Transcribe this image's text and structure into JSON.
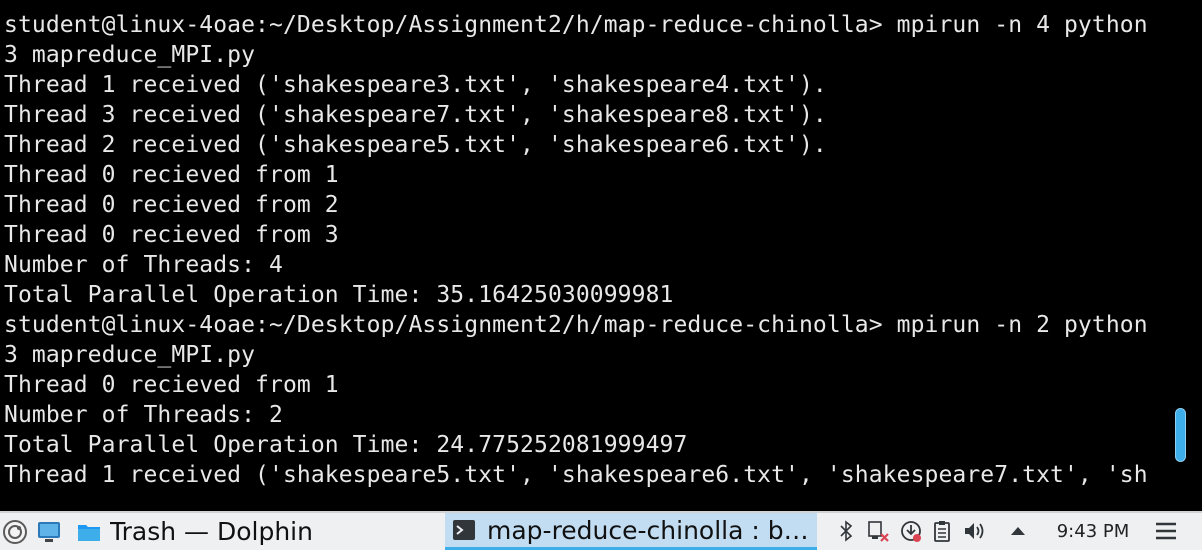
{
  "terminal": {
    "lines": [
      "student@linux-4oae:~/Desktop/Assignment2/h/map-reduce-chinolla> mpirun -n 4 python",
      "3 mapreduce_MPI.py",
      "Thread 1 received ('shakespeare3.txt', 'shakespeare4.txt').",
      "Thread 3 received ('shakespeare7.txt', 'shakespeare8.txt').",
      "Thread 2 received ('shakespeare5.txt', 'shakespeare6.txt').",
      "Thread 0 recieved from 1",
      "Thread 0 recieved from 2",
      "Thread 0 recieved from 3",
      "Number of Threads: 4",
      "Total Parallel Operation Time: 35.16425030099981",
      "student@linux-4oae:~/Desktop/Assignment2/h/map-reduce-chinolla> mpirun -n 2 python",
      "3 mapreduce_MPI.py",
      "Thread 0 recieved from 1",
      "Number of Threads: 2",
      "Total Parallel Operation Time: 24.775252081999497",
      "Thread 1 received ('shakespeare5.txt', 'shakespeare6.txt', 'shakespeare7.txt', 'sh"
    ],
    "scroll_position": 0.85
  },
  "taskbar": {
    "launcher_icon": "opensuse-icon",
    "show_desktop_icon": "desktop-icon",
    "tasks": [
      {
        "label": "Trash — Dolphin",
        "icon": "folder-icon"
      },
      {
        "label": "map-reduce-chinolla : b…",
        "icon": "terminal-icon"
      }
    ],
    "tray_icons": [
      "bluetooth-icon",
      "network-disconnected-icon",
      "updates-icon",
      "clipboard-icon",
      "volume-icon",
      "expand-tray-icon"
    ],
    "clock": "9:43 PM",
    "menu_icon": "hamburger-icon"
  },
  "colors": {
    "terminal_bg": "#000000",
    "terminal_fg": "#e8e8e8",
    "accent": "#3daee9",
    "taskbar_bg": "#eff0f1"
  }
}
